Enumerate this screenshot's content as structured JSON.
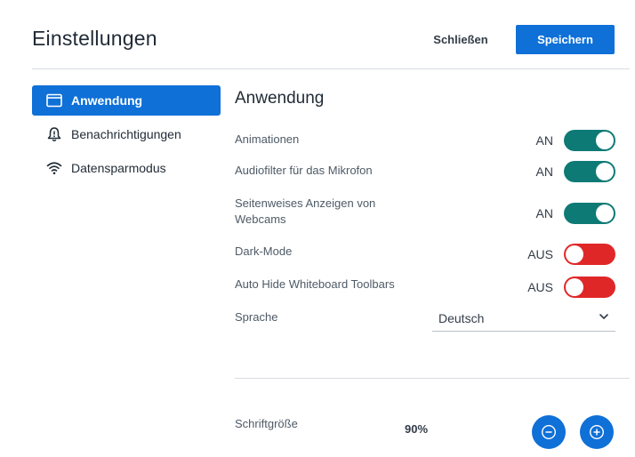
{
  "header": {
    "title": "Einstellungen",
    "close_label": "Schließen",
    "save_label": "Speichern"
  },
  "sidebar": {
    "items": [
      {
        "label": "Anwendung",
        "icon": "window-icon",
        "active": true
      },
      {
        "label": "Benachrichtigungen",
        "icon": "bell-alert-icon",
        "active": false
      },
      {
        "label": "Datensparmodus",
        "icon": "wifi-icon",
        "active": false
      }
    ]
  },
  "main": {
    "section_title": "Anwendung",
    "settings": [
      {
        "label": "Animationen",
        "state_label": "AN",
        "on": true
      },
      {
        "label": "Audiofilter für das Mikrofon",
        "state_label": "AN",
        "on": true
      },
      {
        "label": "Seitenweises Anzeigen von Webcams",
        "state_label": "AN",
        "on": true
      },
      {
        "label": "Dark-Mode",
        "state_label": "AUS",
        "on": false
      },
      {
        "label": "Auto Hide Whiteboard Toolbars",
        "state_label": "AUS",
        "on": false
      }
    ],
    "language": {
      "label": "Sprache",
      "value": "Deutsch"
    },
    "font_size": {
      "label": "Schriftgröße",
      "value": "90%",
      "decrease_icon": "minus-circle-icon",
      "increase_icon": "plus-circle-icon"
    }
  },
  "colors": {
    "primary": "#0f70d7",
    "toggle_on": "#0e7a75",
    "toggle_off": "#e02727"
  }
}
